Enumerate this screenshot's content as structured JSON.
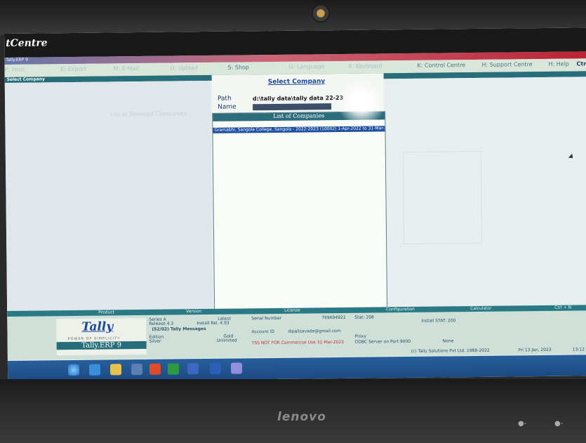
{
  "brand": {
    "text": "tCentre"
  },
  "window": {
    "title": "Tally.ERP 9"
  },
  "menu": {
    "items": [
      {
        "label": "P: Print",
        "dim": true
      },
      {
        "label": "E: Export",
        "dim": true
      },
      {
        "label": "M: E-Mail",
        "dim": true
      },
      {
        "label": "O: Upload",
        "dim": true
      },
      {
        "label": "S: Shop",
        "dim": false
      },
      {
        "label": "G: Language",
        "dim": true
      },
      {
        "label": "K: Keyboard",
        "dim": true
      },
      {
        "label": "K: Control Centre",
        "dim": false
      },
      {
        "label": "H: Support Centre",
        "dim": false
      },
      {
        "label": "H: Help",
        "dim": false
      }
    ],
    "ctrl": "Ctr"
  },
  "section_header": "Select Company",
  "left_dim": "List of Selected Companies",
  "select_company": {
    "title": "Select Company",
    "path_label": "Path",
    "path_value": "d:\\tally data\\tally data 22-23",
    "name_label": "Name"
  },
  "list": {
    "header": "List of Companies",
    "rows": [
      "Gramabhi, Sangola College, Sangola - 2022-2023 (10002) 1-Apr-2022 to 31-Mar-2023"
    ]
  },
  "bottom": {
    "headers": {
      "product": "Product",
      "version": "Version",
      "license": "License",
      "configuration": "Configuration",
      "calculator": "Calculator",
      "ctrl": "Ctrl + N"
    },
    "logo": "Tally",
    "tagline": "POWER OF SIMPLICITY",
    "product_name": "Tally.ERP 9",
    "series": "Series A",
    "release": "Release 4.3",
    "install_rel": "Install Rel. 4.93",
    "latest": "Latest",
    "messages": "(52/02) Tally Messages",
    "edition": "Edition",
    "silver": "Silver",
    "gold": "Gold",
    "unlimited": "Unlimited",
    "serial_label": "Serial Number",
    "serial_value": "769694922",
    "account_label": "Account ID",
    "account_value": "dipalisavade@gmail.com",
    "net_warning": "TSS NOT FOR Commercial Use 31-Mar-2023",
    "stat": "Stat: 208",
    "install_stat": "Install STAT: 200",
    "proxy": "Proxy",
    "odbc": "ODBC Server on Port 9000",
    "none": "None",
    "copyright": "(c) Tally Solutions Pvt Ltd. 1988-2022",
    "date": "Fri 13 Jan, 2023",
    "time": "13:12"
  }
}
